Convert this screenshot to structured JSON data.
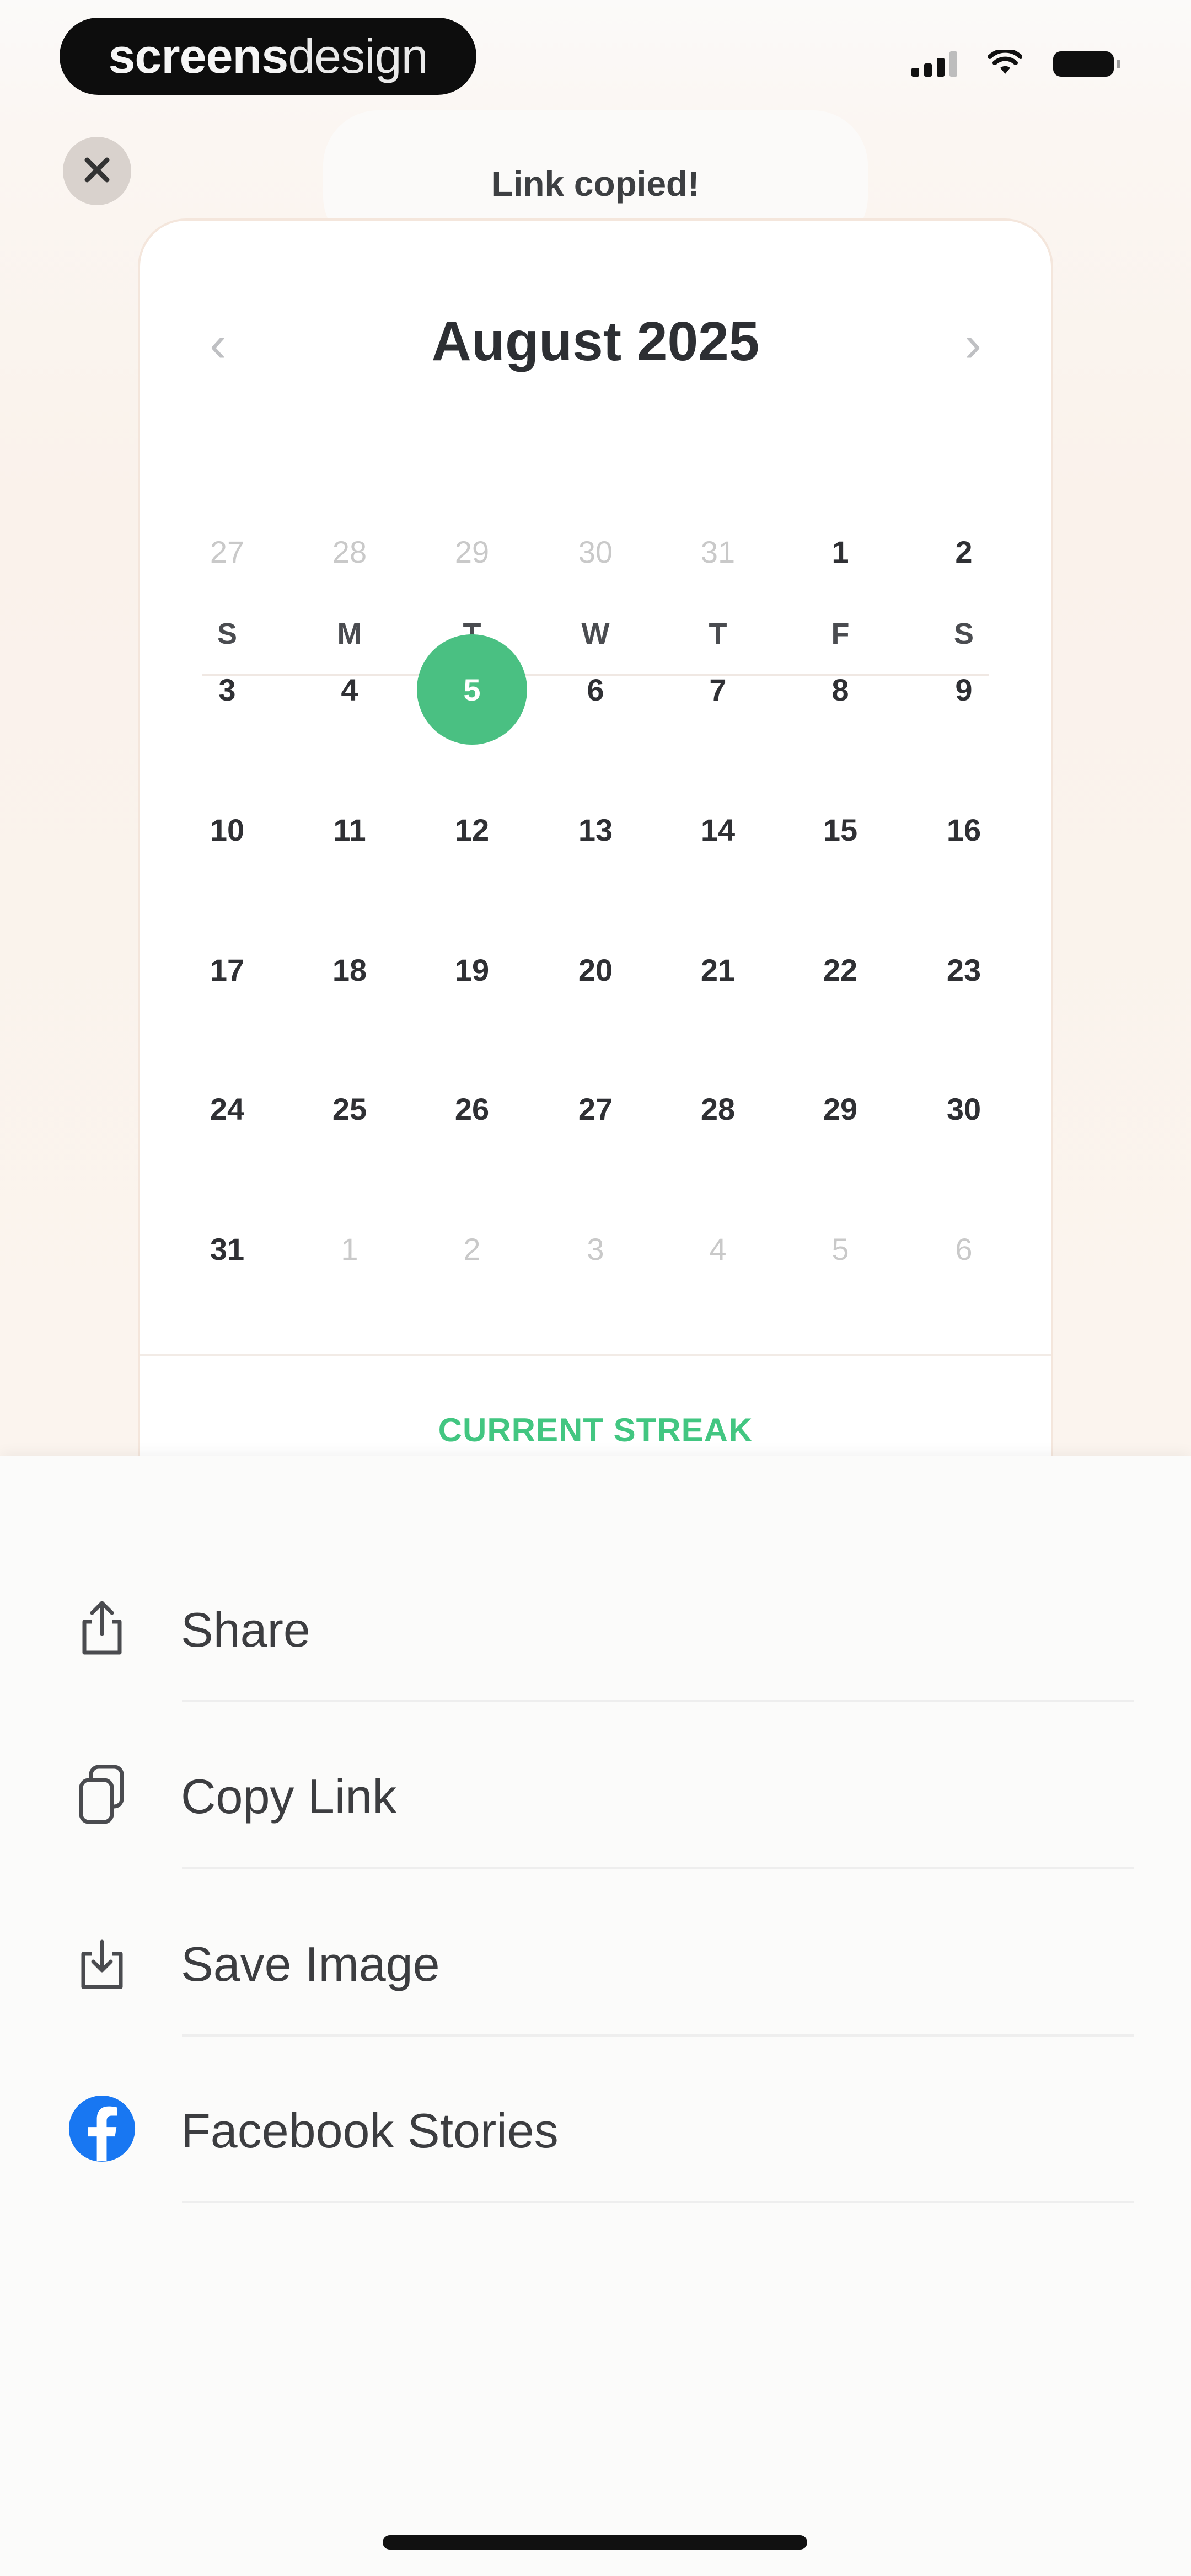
{
  "status_bar": {
    "watermark_bold": "screens",
    "watermark_light": "design",
    "signal_icon": "signal-icon",
    "wifi_icon": "wifi-icon",
    "battery_icon": "battery-icon"
  },
  "close_icon": "close-icon",
  "toast": {
    "text": "Link copied!"
  },
  "calendar": {
    "month_title": "August 2025",
    "prev_icon": "chevron-left-icon",
    "next_icon": "chevron-right-icon",
    "weekdays": [
      "S",
      "M",
      "T",
      "W",
      "T",
      "F",
      "S"
    ],
    "weeks": [
      [
        "27",
        "28",
        "29",
        "30",
        "31",
        "1",
        "2"
      ],
      [
        "3",
        "4",
        "5",
        "6",
        "7",
        "8",
        "9"
      ],
      [
        "10",
        "11",
        "12",
        "13",
        "14",
        "15",
        "16"
      ],
      [
        "17",
        "18",
        "19",
        "20",
        "21",
        "22",
        "23"
      ],
      [
        "24",
        "25",
        "26",
        "27",
        "28",
        "29",
        "30"
      ],
      [
        "31",
        "1",
        "2",
        "3",
        "4",
        "5",
        "6"
      ]
    ],
    "selected_day": "5",
    "streak_label": "CURRENT STREAK",
    "accent_color": "#4AC082"
  },
  "share_sheet": {
    "items": [
      {
        "label": "Share",
        "icon": "share-icon"
      },
      {
        "label": "Copy Link",
        "icon": "copy-link-icon"
      },
      {
        "label": "Save Image",
        "icon": "save-image-icon"
      },
      {
        "label": "Facebook Stories",
        "icon": "facebook-icon"
      }
    ]
  }
}
